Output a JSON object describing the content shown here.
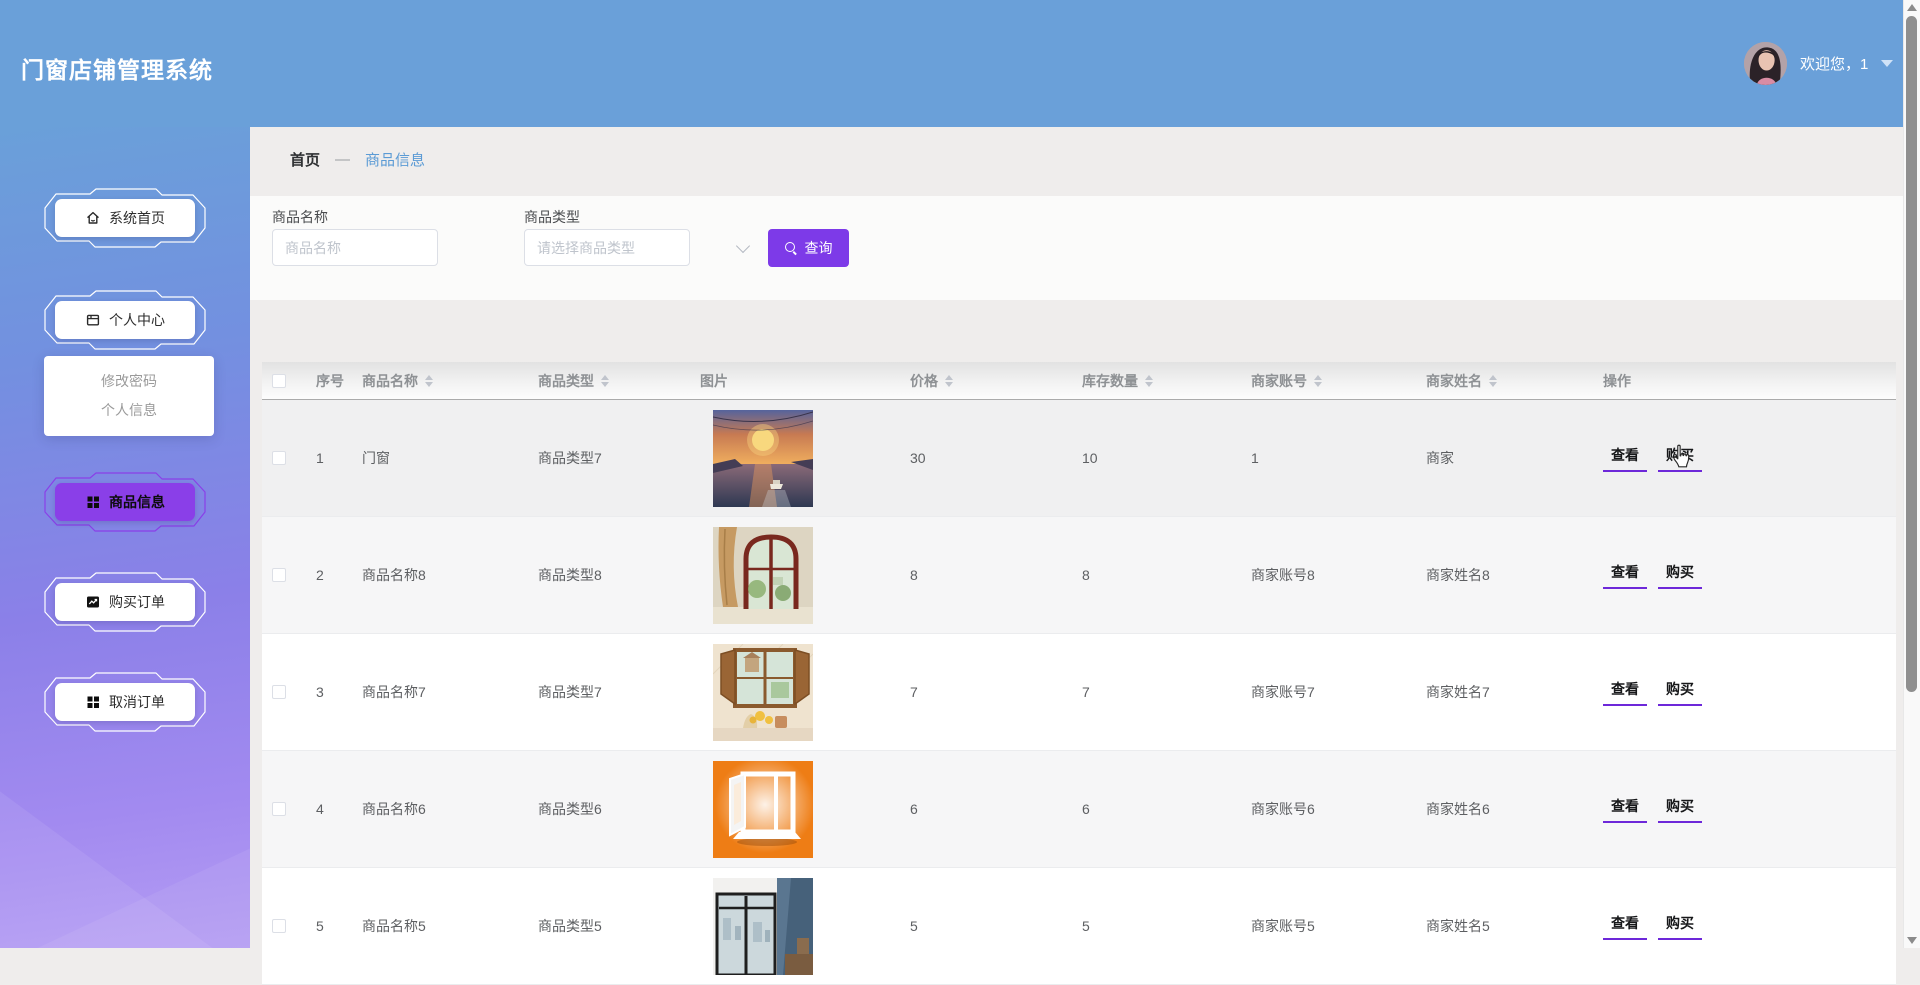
{
  "app": {
    "title": "门窗店铺管理系统"
  },
  "user": {
    "welcome": "欢迎您，1",
    "avatar": "female-portrait"
  },
  "sidebar": {
    "items": [
      {
        "label": "系统首页",
        "icon": "home-icon",
        "active": false
      },
      {
        "label": "个人中心",
        "icon": "layout-icon",
        "active": false
      },
      {
        "label": "商品信息",
        "icon": "grid-icon",
        "active": true
      },
      {
        "label": "购买订单",
        "icon": "chart-icon",
        "active": false
      },
      {
        "label": "取消订单",
        "icon": "grid-icon",
        "active": false
      }
    ],
    "submenu": [
      {
        "label": "修改密码"
      },
      {
        "label": "个人信息"
      }
    ]
  },
  "breadcrumb": {
    "home": "首页",
    "separator": "—",
    "current": "商品信息"
  },
  "filters": {
    "name_label": "商品名称",
    "name_placeholder": "商品名称",
    "name_value": "",
    "type_label": "商品类型",
    "type_placeholder": "请选择商品类型",
    "type_value": "",
    "search_button": "查询"
  },
  "table": {
    "columns": [
      {
        "label": "序号",
        "sortable": false
      },
      {
        "label": "商品名称",
        "sortable": true
      },
      {
        "label": "商品类型",
        "sortable": true
      },
      {
        "label": "图片",
        "sortable": false
      },
      {
        "label": "价格",
        "sortable": true
      },
      {
        "label": "库存数量",
        "sortable": true
      },
      {
        "label": "商家账号",
        "sortable": true
      },
      {
        "label": "商家姓名",
        "sortable": true
      },
      {
        "label": "操作",
        "sortable": false
      }
    ],
    "rows": [
      {
        "seq": "1",
        "name": "门窗",
        "type": "商品类型7",
        "image": "sunset-river-boat",
        "price": "30",
        "stock": "10",
        "merchant_account": "1",
        "merchant_name": "商家"
      },
      {
        "seq": "2",
        "name": "商品名称8",
        "type": "商品类型8",
        "image": "arched-wooden-door",
        "price": "8",
        "stock": "8",
        "merchant_account": "商家账号8",
        "merchant_name": "商家姓名8"
      },
      {
        "seq": "3",
        "name": "商品名称7",
        "type": "商品类型7",
        "image": "wooden-window-flowers",
        "price": "7",
        "stock": "7",
        "merchant_account": "商家账号7",
        "merchant_name": "商家姓名7"
      },
      {
        "seq": "4",
        "name": "商品名称6",
        "type": "商品类型6",
        "image": "white-window-orange",
        "price": "6",
        "stock": "6",
        "merchant_account": "商家账号6",
        "merchant_name": "商家姓名6"
      },
      {
        "seq": "5",
        "name": "商品名称5",
        "type": "商品类型5",
        "image": "interior-black-window",
        "price": "5",
        "stock": "5",
        "merchant_account": "商家账号5",
        "merchant_name": "商家姓名5"
      }
    ],
    "actions": {
      "view": "查看",
      "buy": "购买"
    }
  },
  "colors": {
    "header_blue": "#6aa0d9",
    "sidebar_purple": "#a28af0",
    "accent_purple": "#7d3ae8",
    "active_menu_purple": "#8a3fe8",
    "action_underline": "#6d28d9",
    "breadcrumb_link": "#5b9bd5"
  }
}
